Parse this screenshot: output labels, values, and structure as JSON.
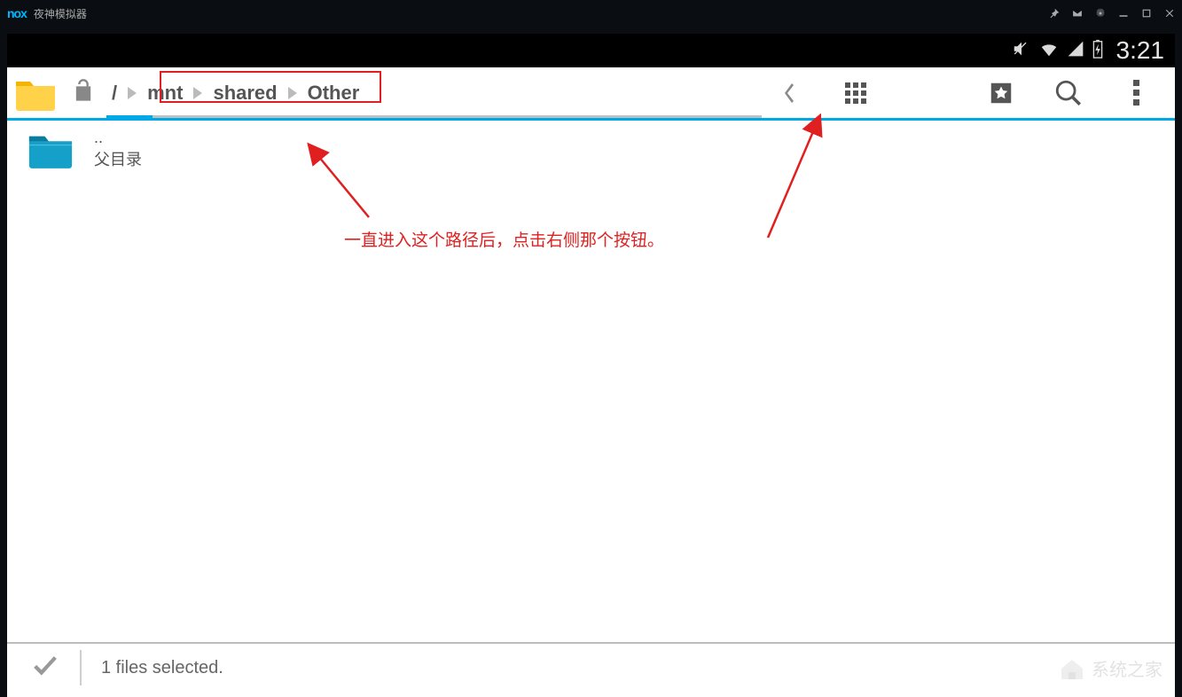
{
  "nox": {
    "logo": "nox",
    "title": "夜神模拟器"
  },
  "android_status": {
    "time": "3:21"
  },
  "breadcrumb": {
    "root": "/",
    "segments": [
      "mnt",
      "shared",
      "Other"
    ]
  },
  "file_list": {
    "parent": {
      "name": "..",
      "label": "父目录"
    }
  },
  "status": {
    "text": "1 files selected."
  },
  "annotation": {
    "text": "一直进入这个路径后，点击右侧那个按钮。"
  },
  "watermark": {
    "text": "系统之家"
  }
}
